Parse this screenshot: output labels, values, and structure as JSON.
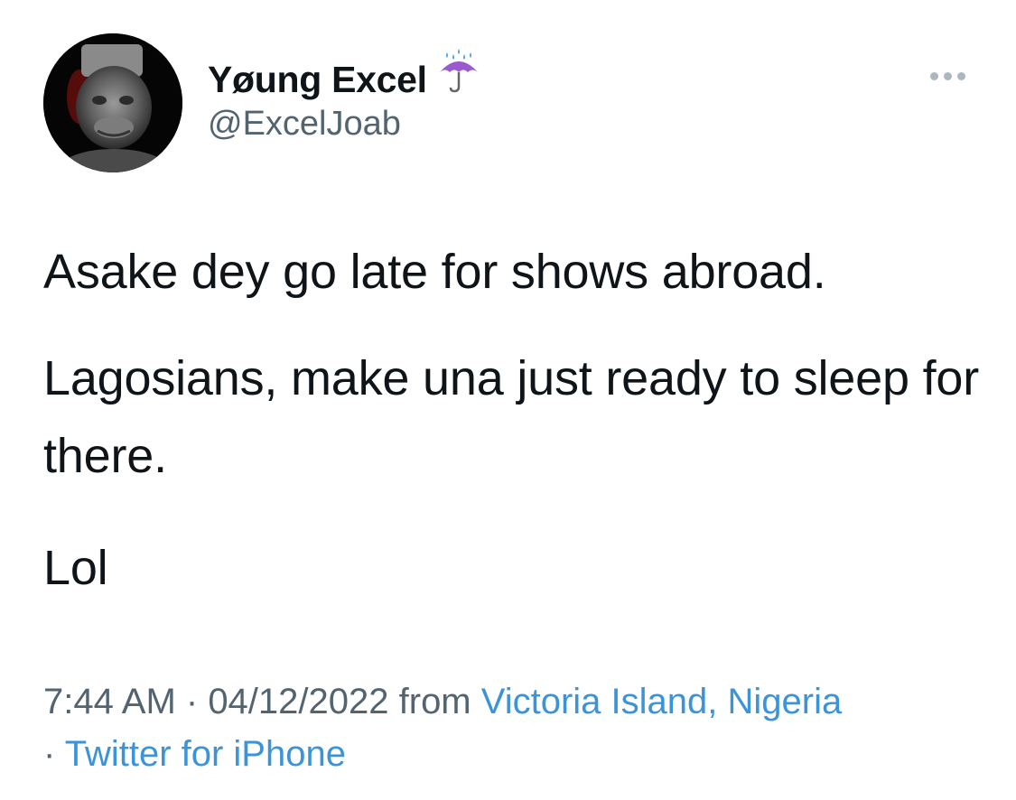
{
  "user": {
    "display_name": "Yøung Excel",
    "handle": "@ExcelJoab",
    "name_emoji": "umbrella-with-rain-icon"
  },
  "tweet": {
    "paragraphs": [
      "Asake dey go late for shows abroad.",
      "Lagosians, make una just ready to sleep for there.",
      "Lol"
    ]
  },
  "meta": {
    "time": "7:44 AM",
    "separator": " · ",
    "date": "04/12/2022",
    "from_label": " from ",
    "location": "Victoria Island, Nigeria",
    "separator2": "· ",
    "source": "Twitter for iPhone"
  },
  "colors": {
    "text": "#0f1419",
    "secondary": "#536471",
    "link": "#3b94d9"
  }
}
